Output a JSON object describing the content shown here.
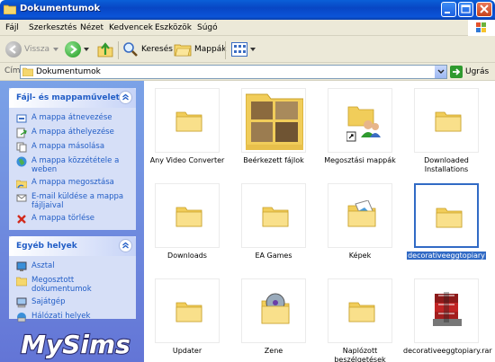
{
  "window": {
    "title": "Dokumentumok"
  },
  "menu": [
    "Fájl",
    "Szerkesztés",
    "Nézet",
    "Kedvencek",
    "Eszközök",
    "Súgó"
  ],
  "toolbar": {
    "back": "Vissza",
    "search": "Keresés",
    "folders": "Mappák"
  },
  "address": {
    "label": "Cím",
    "value": "Dokumentumok",
    "go": "Ugrás"
  },
  "tasks": {
    "title": "Fájl- és mappaműveletek",
    "items": [
      {
        "label": "A mappa átnevezése",
        "icon": "rename-icon"
      },
      {
        "label": "A mappa áthelyezése",
        "icon": "move-icon"
      },
      {
        "label": "A mappa másolása",
        "icon": "copy-icon"
      },
      {
        "label": "A mappa közzététele a weben",
        "icon": "globe-icon"
      },
      {
        "label": "A mappa megosztása",
        "icon": "share-icon"
      },
      {
        "label": "E-mail küldése a mappa fájljaival",
        "icon": "email-icon"
      },
      {
        "label": "A mappa törlése",
        "icon": "delete-icon"
      }
    ]
  },
  "places": {
    "title": "Egyéb helyek",
    "items": [
      {
        "label": "Asztal",
        "icon": "desktop-icon"
      },
      {
        "label": "Megosztott dokumentumok",
        "icon": "shared-folder-icon"
      },
      {
        "label": "Sajátgép",
        "icon": "computer-icon"
      },
      {
        "label": "Hálózati helyek",
        "icon": "network-icon"
      }
    ]
  },
  "branding": "MySims",
  "files": [
    {
      "name": "Any Video Converter",
      "type": "folder"
    },
    {
      "name": "Beérkezett fájlok",
      "type": "photo-folder"
    },
    {
      "name": "Megosztási mappák",
      "type": "shortcut-share"
    },
    {
      "name": "Downloaded Installations",
      "type": "folder"
    },
    {
      "name": "Downloads",
      "type": "folder"
    },
    {
      "name": "EA Games",
      "type": "folder"
    },
    {
      "name": "Képek",
      "type": "pictures-folder"
    },
    {
      "name": "decorativeeggtopiary",
      "type": "folder",
      "selected": true
    },
    {
      "name": "Updater",
      "type": "folder"
    },
    {
      "name": "Zene",
      "type": "music-folder"
    },
    {
      "name": "Naplózott beszélgetések",
      "type": "folder"
    },
    {
      "name": "decorativeeggtopiary.rar",
      "type": "rar"
    }
  ],
  "colors": {
    "titlebar": "#0a5fd8",
    "sidebar": "#7ba2e7",
    "task_link": "#215dc6",
    "selection": "#316ac5"
  }
}
